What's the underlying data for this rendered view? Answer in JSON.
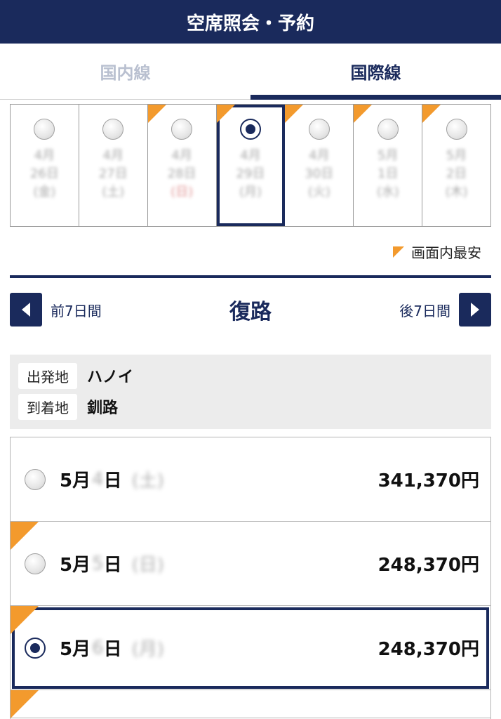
{
  "header": {
    "title": "空席照会・予約"
  },
  "tabs": [
    {
      "label": "国内線",
      "active": false
    },
    {
      "label": "国際線",
      "active": true
    }
  ],
  "date_strip": [
    {
      "month": "4月",
      "day": "26日",
      "weekday": "(金)",
      "selected": false,
      "cheapest": false
    },
    {
      "month": "4月",
      "day": "27日",
      "weekday": "(土)",
      "selected": false,
      "cheapest": false
    },
    {
      "month": "4月",
      "day": "28日",
      "weekday": "(日)",
      "selected": false,
      "cheapest": true
    },
    {
      "month": "4月",
      "day": "29日",
      "weekday": "(月)",
      "selected": true,
      "cheapest": true
    },
    {
      "month": "4月",
      "day": "30日",
      "weekday": "(火)",
      "selected": false,
      "cheapest": true
    },
    {
      "month": "5月",
      "day": "1日",
      "weekday": "(水)",
      "selected": false,
      "cheapest": true
    },
    {
      "month": "5月",
      "day": "2日",
      "weekday": "(木)",
      "selected": false,
      "cheapest": true
    }
  ],
  "legend": {
    "label": "画面内最安"
  },
  "nav": {
    "prev_label": "前7日間",
    "title": "復路",
    "next_label": "後7日間"
  },
  "route": {
    "origin_label": "出発地",
    "origin_value": "ハノイ",
    "destination_label": "到着地",
    "destination_value": "釧路"
  },
  "flights": [
    {
      "month": "5月",
      "day": "4",
      "day_suffix": "日",
      "weekday": "(土)",
      "price": "341,370円",
      "cheapest": false,
      "selected": false
    },
    {
      "month": "5月",
      "day": "5",
      "day_suffix": "日",
      "weekday": "(日)",
      "price": "248,370円",
      "cheapest": true,
      "selected": false
    },
    {
      "month": "5月",
      "day": "6",
      "day_suffix": "日",
      "weekday": "(月)",
      "price": "248,370円",
      "cheapest": true,
      "selected": true
    }
  ],
  "colors": {
    "brand_navy": "#1a2a5c",
    "cheapest_flag": "#f39a2d",
    "route_bg": "#ececec"
  }
}
